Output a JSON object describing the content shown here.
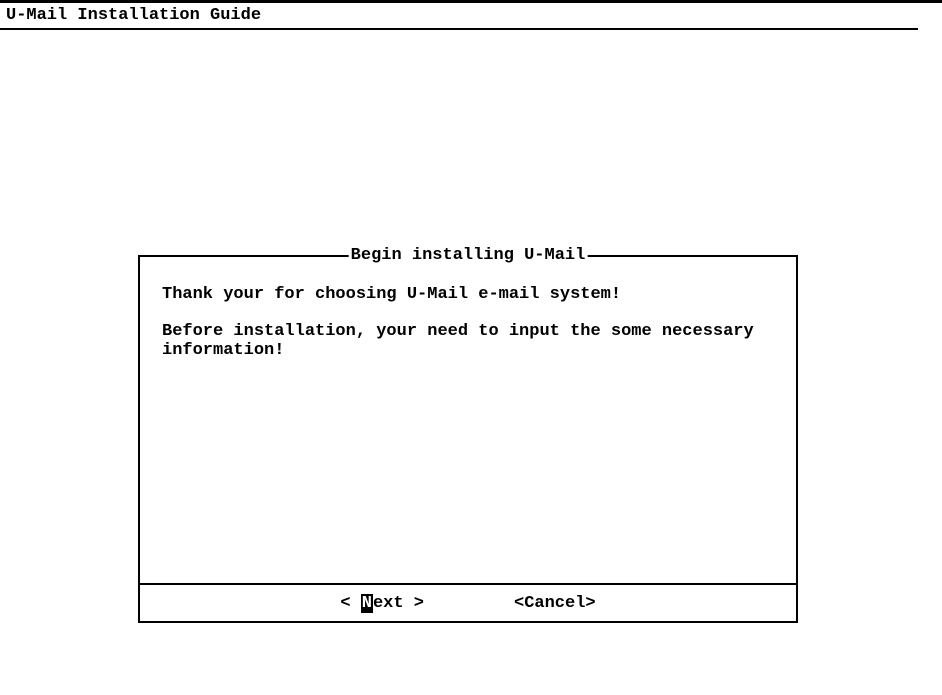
{
  "page": {
    "title": "U-Mail Installation Guide"
  },
  "dialog": {
    "title": "Begin installing U-Mail",
    "paragraph1": "Thank your for choosing U-Mail e-mail system!",
    "paragraph2": "Before installation, your need to input the some necessary information!"
  },
  "buttons": {
    "next": {
      "prefix": "< ",
      "hotkey": "N",
      "rest": "ext >"
    },
    "cancel": {
      "label": "<Cancel>"
    }
  }
}
